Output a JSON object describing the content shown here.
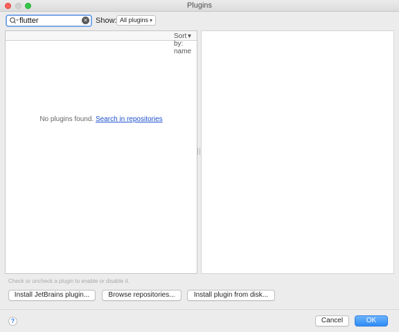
{
  "window": {
    "title": "Plugins"
  },
  "toolbar": {
    "search_value": "flutter",
    "show_label": "Show:",
    "show_selected": "All plugins"
  },
  "list": {
    "sort_label": "Sort by: name",
    "empty_message": "No plugins found.",
    "search_link": "Search in repositories"
  },
  "hint": "Check or uncheck a plugin to enable or disable it.",
  "buttons": {
    "install_jetbrains": "Install JetBrains plugin...",
    "browse_repos": "Browse repositories...",
    "install_disk": "Install plugin from disk...",
    "cancel": "Cancel",
    "ok": "OK",
    "help": "?"
  },
  "colors": {
    "accent": "#2f8bf6",
    "link": "#1b4ecf"
  }
}
